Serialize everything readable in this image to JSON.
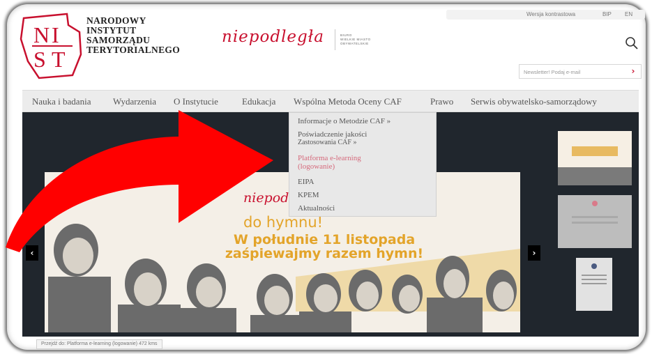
{
  "logo": {
    "lines": [
      "NARODOWY",
      "INSTYTUT",
      "SAMORZĄDU",
      "TERYTORIALNEGO"
    ],
    "mark_letters": "NIST"
  },
  "campaign": {
    "script": "niepodległa",
    "small_lines": [
      "BIURO",
      "WIELKIE MIASTO",
      "OBYWATELSKIE"
    ]
  },
  "top_links": {
    "wersja": "Wersja kontrastowa",
    "bip": "BIP",
    "lang": "EN"
  },
  "newsletter": {
    "placeholder": "Newsletter! Podaj e-mail",
    "button_icon": "chevron-right-icon"
  },
  "nav": {
    "items": [
      "Nauka i badania",
      "Wydarzenia",
      "O Instytucie",
      "Edukacja",
      "Wspólna Metoda Oceny CAF",
      "Prawo",
      "Serwis obywatelsko-samorządowy"
    ]
  },
  "dropdown": {
    "items": [
      "Informacje o Metodzie CAF »",
      "Poświadczenie jakości",
      "Zastosowania CAF »",
      "Platforma e-learning",
      "(logowanie)",
      "EIPA",
      "KPEM",
      "Aktualności"
    ]
  },
  "slide": {
    "script": "niepodległa",
    "doh": "do hymnu!",
    "title_line1": "W południe 11 listopada",
    "title_line2": "zaśpiewajmy razem hymn!"
  },
  "status_bar": "Przejdź do: Platforma e-learning (logowanie) 472 kms",
  "colors": {
    "brand_red": "#c8102e",
    "accent_gold": "#e3a42a",
    "arrow_red": "#ff0000",
    "dark_bg": "#20262d",
    "active_link": "#d5697b"
  }
}
